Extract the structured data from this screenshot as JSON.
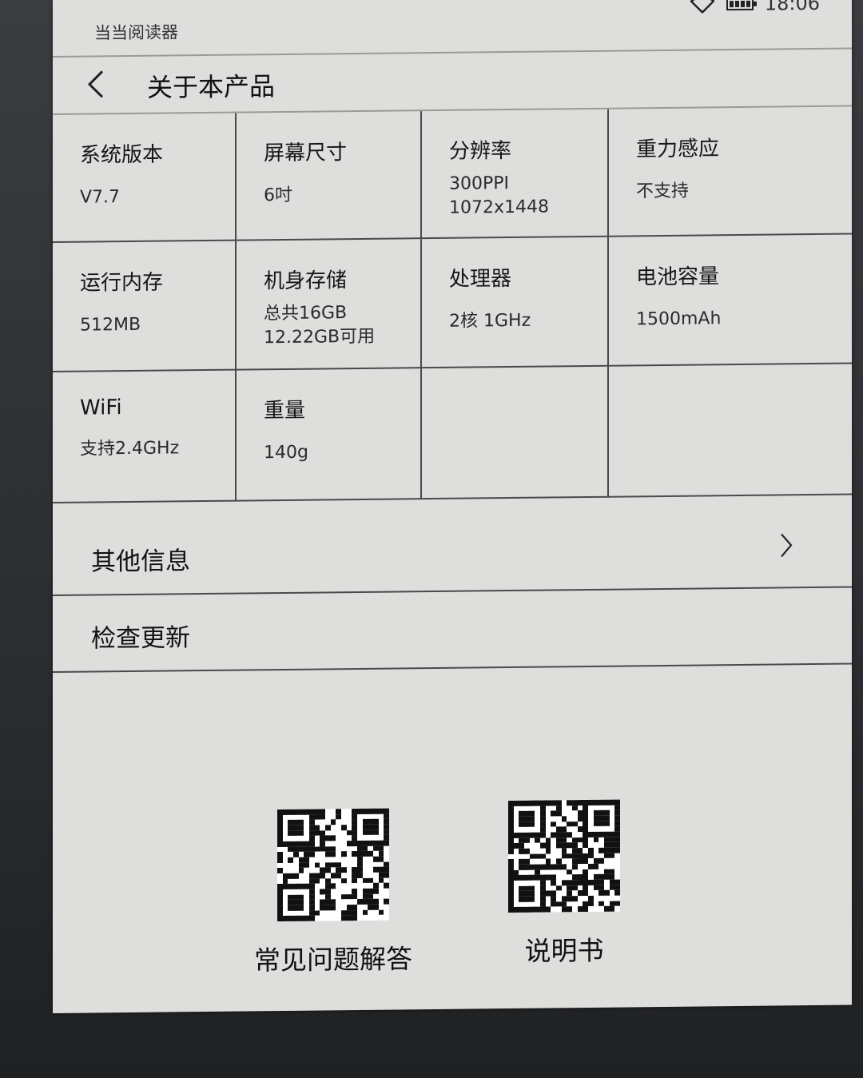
{
  "status_bar": {
    "app_name": "当当阅读器",
    "time": "18:06",
    "wifi_icon": "wifi-icon",
    "battery_icon": "battery-icon"
  },
  "header": {
    "back_icon": "chevron-left-icon",
    "title": "关于本产品"
  },
  "specs": [
    {
      "label": "系统版本",
      "value": "V7.7"
    },
    {
      "label": "屏幕尺寸",
      "value": "6吋"
    },
    {
      "label": "分辨率",
      "value": "300PPI\n1072x1448"
    },
    {
      "label": "重力感应",
      "value": "不支持"
    },
    {
      "label": "运行内存",
      "value": "512MB"
    },
    {
      "label": "机身存储",
      "value": "总共16GB\n12.22GB可用"
    },
    {
      "label": "处理器",
      "value": "2核  1GHz"
    },
    {
      "label": "电池容量",
      "value": "1500mAh"
    },
    {
      "label": "WiFi",
      "value": "支持2.4GHz"
    },
    {
      "label": "重量",
      "value": "140g"
    },
    {
      "label": "",
      "value": ""
    },
    {
      "label": "",
      "value": ""
    }
  ],
  "rows": {
    "other_info": "其他信息",
    "check_update": "检查更新"
  },
  "qr_codes": {
    "faq_label": "常见问题解答",
    "manual_label": "说明书"
  }
}
